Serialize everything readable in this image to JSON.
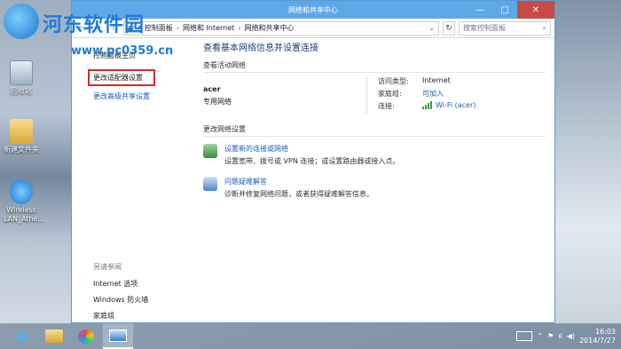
{
  "watermark": {
    "title": "河东软件园",
    "url": "www.pc0359.cn"
  },
  "desktop": {
    "icons": [
      {
        "label": "回收站"
      },
      {
        "label": "新建文件夹"
      },
      {
        "label": "Wireless LAN_Athe..."
      }
    ]
  },
  "window": {
    "title": "网络和共享中心",
    "controls": {
      "minimize": "—",
      "maximize": "□",
      "close": "✕"
    },
    "address": {
      "crumbs": [
        "控制面板",
        "网络和 Internet",
        "网络和共享中心"
      ]
    },
    "search": {
      "placeholder": "搜索控制面板"
    }
  },
  "sidebar": {
    "home": "控制面板主页",
    "links": [
      "更改适配器设置",
      "更改高级共享设置"
    ],
    "see_also": {
      "header": "另请参阅",
      "items": [
        "Internet 选项",
        "Windows 防火墙",
        "家庭组"
      ]
    }
  },
  "main": {
    "heading": "查看基本网络信息并设置连接",
    "active_networks_header": "查看活动网络",
    "network": {
      "name": "acer",
      "type": "专用网络",
      "access_type_label": "访问类型:",
      "access_type_value": "Internet",
      "homegroup_label": "家庭组:",
      "homegroup_value": "可加入",
      "connections_label": "连接:",
      "connections_value": "Wi-Fi (acer)"
    },
    "change_settings_header": "更改网络设置",
    "tasks": [
      {
        "link": "设置新的连接或网络",
        "desc": "设置宽带、拨号或 VPN 连接；或设置路由器或接入点。"
      },
      {
        "link": "问题疑难解答",
        "desc": "诊断并修复网络问题，或者获得疑难解答信息。"
      }
    ]
  },
  "taskbar": {
    "time": "16:03",
    "date": "2014/7/27"
  },
  "colors": {
    "accent": "#5fa8e8",
    "link": "#1a5fb4",
    "highlight": "#d12b2b"
  }
}
